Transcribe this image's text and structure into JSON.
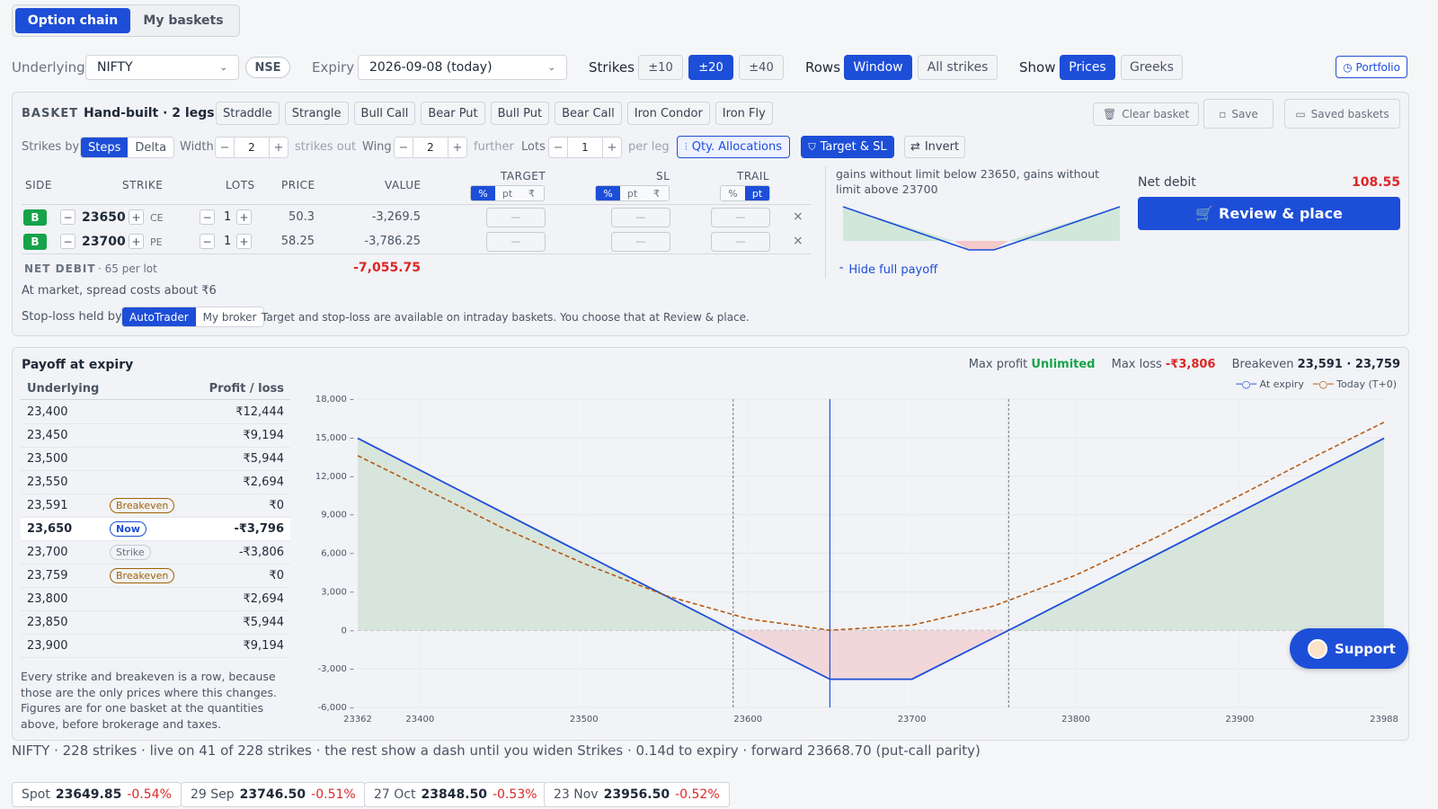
{
  "top_tabs": [
    "Option chain",
    "My baskets"
  ],
  "controls": {
    "underlying_label": "Underlying",
    "underlying_value": "NIFTY",
    "exchange": "NSE",
    "expiry_label": "Expiry",
    "expiry_value": "2026-09-08 (today)",
    "strikes_label": "Strikes",
    "strikes_options": [
      "±10",
      "±20",
      "±40"
    ],
    "strikes_selected": "±20",
    "rows_label": "Rows",
    "rows_options": [
      "Window",
      "All strikes"
    ],
    "show_label": "Show",
    "show_options": [
      "Prices",
      "Greeks"
    ],
    "portfolio": "Portfolio"
  },
  "basket": {
    "label": "BASKET",
    "name": "Hand-built · 2 legs",
    "presets": [
      "Straddle",
      "Strangle",
      "Bull Call",
      "Bear Put",
      "Bull Put",
      "Bear Call",
      "Iron Condor",
      "Iron Fly"
    ],
    "clear": "Clear basket",
    "save": "Save",
    "saved": "Saved baskets",
    "strikes_by_label": "Strikes by",
    "strikes_by_options": [
      "Steps",
      "Delta"
    ],
    "width_label": "Width",
    "width_value": "2",
    "width_suffix": "strikes out",
    "wing_label": "Wing",
    "wing_value": "2",
    "wing_suffix": "further",
    "lots_label": "Lots",
    "lots_value": "1",
    "lots_suffix": "per leg",
    "qty_alloc": "Qty. Allocations",
    "target_sl": "Target & SL",
    "invert": "Invert",
    "headers": {
      "side": "SIDE",
      "strike": "STRIKE",
      "lots": "LOTS",
      "price": "PRICE",
      "value": "VALUE",
      "target": "TARGET",
      "sl": "SL",
      "trail": "TRAIL"
    },
    "toggle": {
      "pct": "%",
      "pt": "pt",
      "rs": "₹"
    },
    "dash": "—",
    "legs": [
      {
        "side": "B",
        "strike": "23650",
        "type": "CE",
        "lots": "1",
        "price": "50.3",
        "value": "-3,269.5"
      },
      {
        "side": "B",
        "strike": "23700",
        "type": "PE",
        "lots": "1",
        "price": "58.25",
        "value": "-3,786.25"
      }
    ],
    "net_label": "NET DEBIT",
    "net_suffix": "· 65 per lot",
    "net_value": "-7,055.75",
    "spread_note": "At market, spread costs about ₹6",
    "sl_held_label": "Stop-loss held by",
    "sl_held_options": [
      "AutoTrader",
      "My broker"
    ],
    "sl_note": "Target and stop-loss are available on intraday baskets. You choose that at Review & place.",
    "payoff_desc": "gains without limit below 23650, gains without limit above 23700",
    "hide_payoff": "Hide full payoff",
    "net_debit_label": "Net debit",
    "net_debit_value": "108.55",
    "review": "Review & place"
  },
  "payoff": {
    "title": "Payoff at expiry",
    "max_profit_label": "Max profit",
    "max_profit": "Unlimited",
    "max_loss_label": "Max loss",
    "max_loss": "-₹3,806",
    "breakeven_label": "Breakeven",
    "breakeven": "23,591 · 23,759",
    "col_underlying": "Underlying",
    "col_pl": "Profit / loss",
    "rows": [
      {
        "u": "23,400",
        "pl": "₹12,444",
        "tag": ""
      },
      {
        "u": "23,450",
        "pl": "₹9,194",
        "tag": ""
      },
      {
        "u": "23,500",
        "pl": "₹5,944",
        "tag": ""
      },
      {
        "u": "23,550",
        "pl": "₹2,694",
        "tag": ""
      },
      {
        "u": "23,591",
        "pl": "₹0",
        "tag": "Breakeven"
      },
      {
        "u": "23,650",
        "pl": "-₹3,796",
        "tag": "Now"
      },
      {
        "u": "23,700",
        "pl": "-₹3,806",
        "tag": "Strike"
      },
      {
        "u": "23,759",
        "pl": "₹0",
        "tag": "Breakeven"
      },
      {
        "u": "23,800",
        "pl": "₹2,694",
        "tag": ""
      },
      {
        "u": "23,850",
        "pl": "₹5,944",
        "tag": ""
      },
      {
        "u": "23,900",
        "pl": "₹9,194",
        "tag": ""
      }
    ],
    "note": "Every strike and breakeven is a row, because those are the only prices where this changes. Figures are for one basket at the quantities above, before brokerage and taxes."
  },
  "chart_data": {
    "type": "line",
    "x_ticks": [
      "23362",
      "23400",
      "23500",
      "23600",
      "23700",
      "23800",
      "23900",
      "23988"
    ],
    "y_ticks": [
      "18,000",
      "15,000",
      "12,000",
      "9,000",
      "6,000",
      "3,000",
      "0",
      "-3,000",
      "-6,000"
    ],
    "xlim": [
      23362,
      23988
    ],
    "ylim": [
      -6000,
      18000
    ],
    "series": [
      {
        "name": "At expiry",
        "color": "#1d4ed8",
        "style": "solid",
        "x": [
          23362,
          23591,
          23650,
          23700,
          23759,
          23988
        ],
        "y": [
          14950,
          0,
          -3806,
          -3806,
          0,
          14950
        ]
      },
      {
        "name": "Today (T+0)",
        "color": "#b45309",
        "style": "dashed",
        "x": [
          23362,
          23400,
          23450,
          23500,
          23550,
          23600,
          23650,
          23700,
          23750,
          23800,
          23850,
          23900,
          23950,
          23988
        ],
        "y": [
          13600,
          11200,
          8000,
          5200,
          2700,
          900,
          10,
          400,
          1900,
          4300,
          7300,
          10500,
          13800,
          16200
        ]
      }
    ],
    "markers": {
      "breakevens": [
        23591,
        23759
      ],
      "now": 23650
    },
    "grid": true,
    "legend": "top-right"
  },
  "footer": {
    "status": "NIFTY · 228 strikes · live on 41 of 228 strikes · the rest show a dash until you widen Strikes · 0.14d to expiry · forward 23668.70 (put-call parity)",
    "chips": [
      {
        "label": "Spot",
        "value": "23649.85",
        "change": "-0.54%"
      },
      {
        "label": "29 Sep",
        "value": "23746.50",
        "change": "-0.51%"
      },
      {
        "label": "27 Oct",
        "value": "23848.50",
        "change": "-0.53%"
      },
      {
        "label": "23 Nov",
        "value": "23956.50",
        "change": "-0.52%"
      }
    ]
  },
  "support": "Support"
}
